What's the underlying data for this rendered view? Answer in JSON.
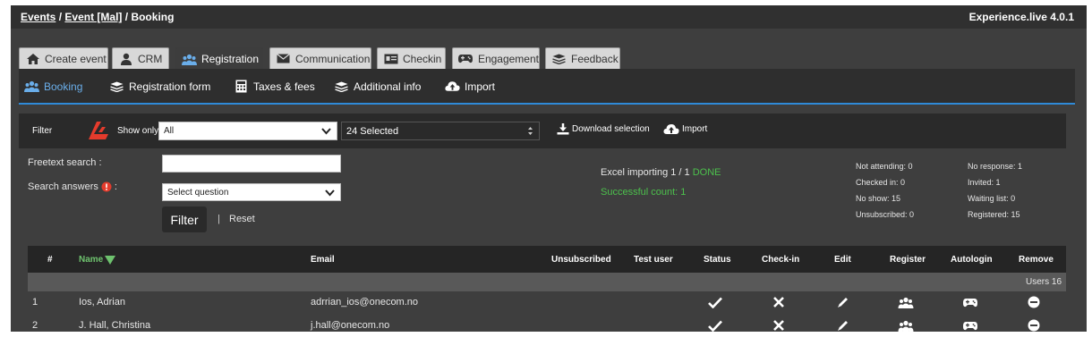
{
  "breadcrumb": {
    "events": "Events",
    "sep1": "/",
    "event": "Event [Mal]",
    "sep2": "/",
    "current": "Booking"
  },
  "app_version": "Experience.live 4.0.1",
  "tabs": [
    {
      "label": "Create event",
      "icon": "home-icon"
    },
    {
      "label": "CRM",
      "icon": "person-icon"
    },
    {
      "label": "Registration",
      "icon": "group-icon",
      "active": true
    },
    {
      "label": "Communication",
      "icon": "envelope-icon"
    },
    {
      "label": "Checkin",
      "icon": "id-card-icon"
    },
    {
      "label": "Engagement",
      "icon": "gamepad-icon"
    },
    {
      "label": "Feedback",
      "icon": "stack-icon"
    }
  ],
  "subnav": [
    {
      "label": "Booking",
      "icon": "group-icon",
      "active": true
    },
    {
      "label": "Registration form",
      "icon": "stack-icon"
    },
    {
      "label": "Taxes & fees",
      "icon": "calculator-icon"
    },
    {
      "label": "Additional info",
      "icon": "stack-icon"
    },
    {
      "label": "Import",
      "icon": "cloud-upload-icon"
    }
  ],
  "filterbar": {
    "filter_label": "Filter",
    "show_only_label": "Show only",
    "show_only_value": "All",
    "selected_value": "24 Selected",
    "download_label": "Download selection",
    "import_label": "Import"
  },
  "search": {
    "freetext_label": "Freetext search :",
    "freetext_value": "",
    "answers_label": "Search answers",
    "answers_suffix": ":",
    "answers_select": "Select question",
    "filter_button": "Filter",
    "separator": "|",
    "reset_link": "Reset"
  },
  "import_status": {
    "text": "Excel importing 1 / 1",
    "done": "DONE",
    "success": "Successful count: 1"
  },
  "stats": {
    "not_attending": "Not attending: 0",
    "checked_in": "Checked in: 0",
    "no_show": "No show: 15",
    "unsubscribed": "Unsubscribed: 0",
    "no_response": "No response: 1",
    "invited": "Invited: 1",
    "waiting_list": "Waiting list: 0",
    "registered": "Registered: 15"
  },
  "table": {
    "headers": {
      "num": "#",
      "name": "Name",
      "email": "Email",
      "unsubscribed": "Unsubscribed",
      "test_user": "Test user",
      "status": "Status",
      "checkin": "Check-in",
      "edit": "Edit",
      "register": "Register",
      "autologin": "Autologin",
      "remove": "Remove"
    },
    "users_count": "Users 16",
    "rows": [
      {
        "num": "1",
        "name": "Ios, Adrian",
        "email": "adrrian_ios@onecom.no"
      },
      {
        "num": "2",
        "name": "J. Hall, Christina",
        "email": "j.hall@onecom.no"
      }
    ]
  },
  "colors": {
    "accent": "#2f8ad8",
    "green": "#6ec26e",
    "done": "#4cc04c",
    "error_red": "#e53b2c"
  }
}
